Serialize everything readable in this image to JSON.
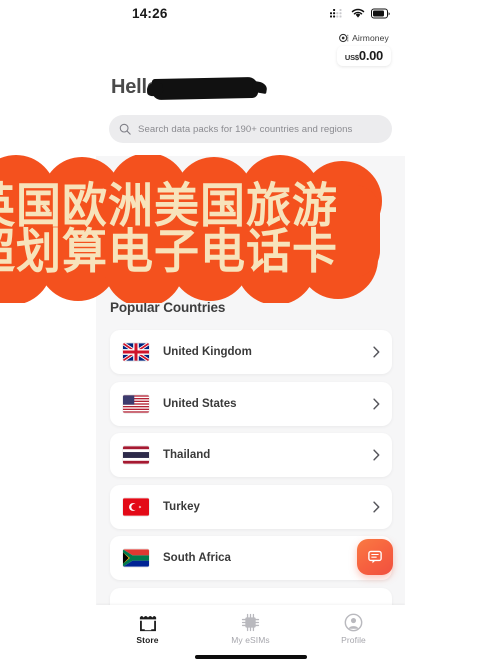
{
  "status_bar": {
    "time": "14:26",
    "icons": [
      "cellular-signal-icon",
      "wifi-icon",
      "battery-icon"
    ]
  },
  "airmoney": {
    "icon": "airmoney-coin-icon",
    "label": "Airmoney",
    "currency": "US$",
    "amount": "0.00"
  },
  "header": {
    "greeting": "Hello,",
    "name_redacted": true
  },
  "search": {
    "icon": "search-icon",
    "placeholder": "Search data packs for 190+ countries and regions",
    "value": ""
  },
  "promo_overlay": {
    "line1": "英国欧洲美国旅游",
    "line2": "超划算电子电话卡",
    "background_color": "#f4511e",
    "text_color": "#f7e3bb"
  },
  "main": {
    "section_title": "Popular Countries",
    "countries": [
      {
        "name": "United Kingdom",
        "flag": "flag-gb",
        "chevron": "chevron-right-icon"
      },
      {
        "name": "United States",
        "flag": "flag-us",
        "chevron": "chevron-right-icon"
      },
      {
        "name": "Thailand",
        "flag": "flag-th",
        "chevron": "chevron-right-icon"
      },
      {
        "name": "Turkey",
        "flag": "flag-tr",
        "chevron": "chevron-right-icon"
      },
      {
        "name": "South Africa",
        "flag": "flag-za",
        "chevron": "chevron-right-icon"
      }
    ]
  },
  "chat_fab": {
    "icon": "chat-bubble-icon",
    "color": "#f6603f"
  },
  "tabbar": {
    "items": [
      {
        "label": "Store",
        "icon": "store-icon",
        "active": true
      },
      {
        "label": "My eSIMs",
        "icon": "sim-chip-icon",
        "active": false
      },
      {
        "label": "Profile",
        "icon": "profile-icon",
        "active": false
      }
    ]
  }
}
